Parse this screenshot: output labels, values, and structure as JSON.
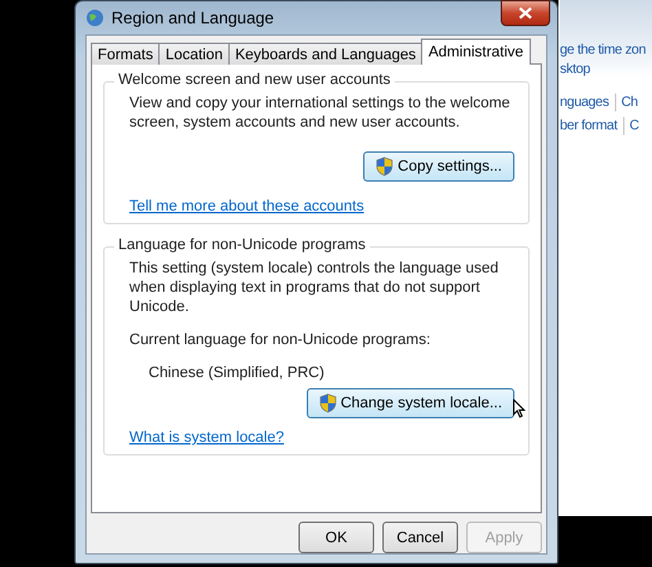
{
  "window": {
    "title": "Region and Language"
  },
  "tabs": [
    {
      "label": "Formats",
      "selected": false
    },
    {
      "label": "Location",
      "selected": false
    },
    {
      "label": "Keyboards and Languages",
      "selected": false
    },
    {
      "label": "Administrative",
      "selected": true
    }
  ],
  "welcome_group": {
    "title": "Welcome screen and new user accounts",
    "text": "View and copy your international settings to the welcome screen, system accounts and new user accounts.",
    "button": "Copy settings...",
    "link": "Tell me more about these accounts"
  },
  "locale_group": {
    "title": "Language for non-Unicode programs",
    "text": "This setting (system locale) controls the language used when displaying text in programs that do not support Unicode.",
    "current_label": "Current language for non-Unicode programs:",
    "current_value": "Chinese (Simplified, PRC)",
    "button": "Change system locale...",
    "link": "What is system locale?"
  },
  "buttons": [
    {
      "label": "OK",
      "disabled": false
    },
    {
      "label": "Cancel",
      "disabled": false
    },
    {
      "label": "Apply",
      "disabled": true
    }
  ],
  "background_window": {
    "links": [
      "ge the time zon",
      "sktop"
    ],
    "link_rows": [
      [
        "nguages",
        "Ch"
      ],
      [
        "ber format",
        "C"
      ]
    ]
  }
}
